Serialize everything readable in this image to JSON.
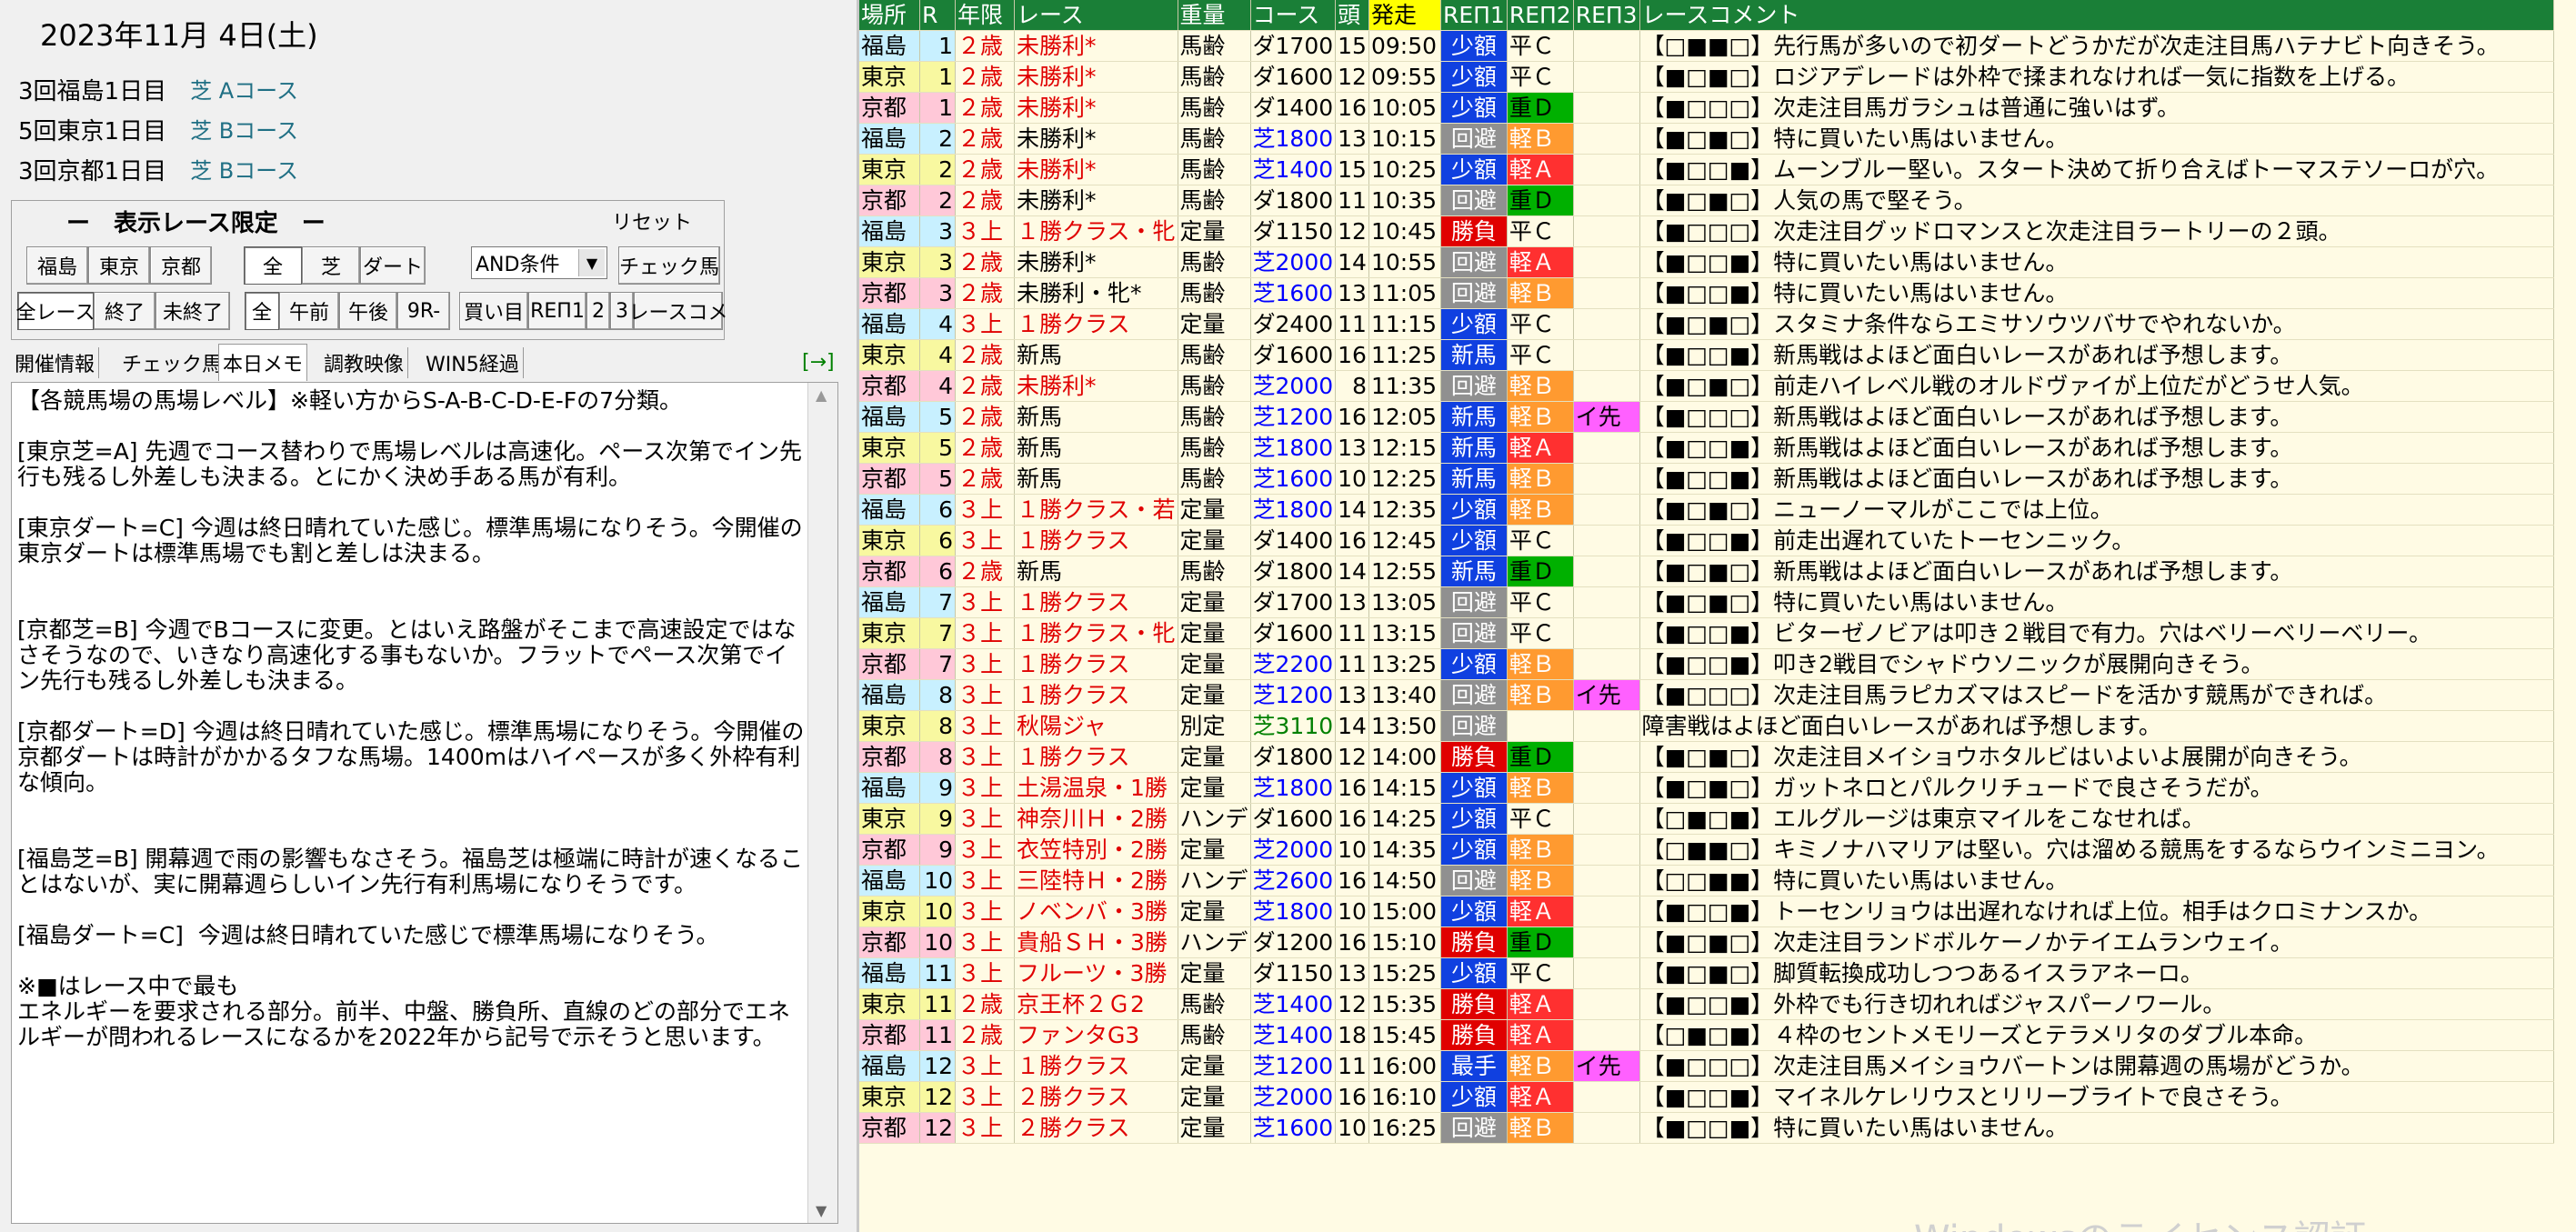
{
  "left": {
    "date": "2023年11月 4日(土)",
    "meets": [
      {
        "name": "3回福島1日目",
        "course": "芝 Aコース"
      },
      {
        "name": "5回東京1日目",
        "course": "芝 Bコース"
      },
      {
        "name": "3回京都1日目",
        "course": "芝 Bコース"
      }
    ],
    "filter": {
      "title": "ー　表示レース限定　ー",
      "reset": "リセット",
      "buttons_row1": [
        "福島",
        "東京",
        "京都",
        "全",
        "芝",
        "ダート"
      ],
      "select_value": "AND条件",
      "check_horse": "チェック馬",
      "buttons_row2": [
        "全レース",
        "終了",
        "未終了",
        "全",
        "午前",
        "午後",
        "9R-",
        "買い目",
        "REΠ1",
        "2",
        "3",
        "レースコメ"
      ]
    },
    "tabs": [
      "開催情報",
      "チェック馬",
      "本日メモ",
      "調教映像",
      "WIN5経過"
    ],
    "tab_arrow": "[→]",
    "memo": "【各競馬場の馬場レベル】※軽い方からS-A-B-C-D-E-Fの7分類。\n\n[東京芝=A] 先週でコース替わりで馬場レベルは高速化。ペース次第でイン先行も残るし外差しも決まる。とにかく決め手ある馬が有利。\n\n[東京ダート=C] 今週は終日晴れていた感じ。標準馬場になりそう。今開催の東京ダートは標準馬場でも割と差しは決まる。\n\n\n[京都芝=B] 今週でBコースに変更。とはいえ路盤がそこまで高速設定ではなさそうなので、いきなり高速化する事もないか。フラットでペース次第でイン先行も残るし外差しも決まる。\n\n[京都ダート=D] 今週は終日晴れていた感じ。標準馬場になりそう。今開催の京都ダートは時計がかかるタフな馬場。1400mはハイペースが多く外枠有利な傾向。\n\n\n[福島芝=B] 開幕週で雨の影響もなさそう。福島芝は極端に時計が速くなることはないが、実に開幕週らしいイン先行有利馬場になりそうです。\n\n[福島ダート=C]  今週は終日晴れていた感じで標準馬場になりそう。\n\n※■はレース中で最も\nエネルギーを要求される部分。前半、中盤、勝負所、直線のどの部分でエネルギーが問われるレースになるかを2022年から記号で示そうと思います。"
  },
  "grid": {
    "headers": [
      "場所",
      "R",
      "年限",
      "レース",
      "重量",
      "コース",
      "頭",
      "発走",
      "REΠ1",
      "REΠ2",
      "REΠ3",
      "レースコメント"
    ],
    "rows": [
      {
        "v": "福島",
        "r": "1",
        "nen": "２歳",
        "race": "未勝利*",
        "jyu": "馬齢",
        "course": "ダ1700",
        "head": "15",
        "time": "09:50",
        "r1": "少額",
        "r2": "平Ｃ",
        "r3": "",
        "cmt": "【□■■□】先行馬が多いので初ダートどうかだが次走注目馬ハテナビト向きそう。"
      },
      {
        "v": "東京",
        "r": "1",
        "nen": "２歳",
        "race": "未勝利*",
        "jyu": "馬齢",
        "course": "ダ1600",
        "head": "12",
        "time": "09:55",
        "r1": "少額",
        "r2": "平Ｃ",
        "r3": "",
        "cmt": "【■□■□】ロジアデレードは外枠で揉まれなければ一気に指数を上げる。"
      },
      {
        "v": "京都",
        "r": "1",
        "nen": "２歳",
        "race": "未勝利*",
        "jyu": "馬齢",
        "course": "ダ1400",
        "head": "16",
        "time": "10:05",
        "r1": "少額",
        "r2": "重Ｄ",
        "r3": "",
        "cmt": "【■□□□】次走注目馬ガラシュは普通に強いはず。"
      },
      {
        "v": "福島",
        "r": "2",
        "nen": "２歳",
        "race": "未勝利*",
        "jyu": "馬齢",
        "course": "芝1800",
        "head": "13",
        "time": "10:15",
        "r1": "回避",
        "r2": "軽Ｂ",
        "r3": "",
        "cmt": "【■□■□】特に買いたい馬はいません。"
      },
      {
        "v": "東京",
        "r": "2",
        "nen": "２歳",
        "race": "未勝利*",
        "jyu": "馬齢",
        "course": "芝1400",
        "head": "15",
        "time": "10:25",
        "r1": "少額",
        "r2": "軽Ａ",
        "r3": "",
        "cmt": "【■□□■】ムーンブルー堅い。スタート決めて折り合えばトーマステソーロが穴。"
      },
      {
        "v": "京都",
        "r": "2",
        "nen": "２歳",
        "race": "未勝利*",
        "jyu": "馬齢",
        "course": "ダ1800",
        "head": "11",
        "time": "10:35",
        "r1": "回避",
        "r2": "重Ｄ",
        "r3": "",
        "cmt": "【■□■□】人気の馬で堅そう。"
      },
      {
        "v": "福島",
        "r": "3",
        "nen": "３上",
        "race": "１勝クラス・牝",
        "jyu": "定量",
        "course": "ダ1150",
        "head": "12",
        "time": "10:45",
        "r1": "勝負",
        "r2": "平Ｃ",
        "r3": "",
        "cmt": "【■□□□】次走注目グッドロマンスと次走注目ラートリーの２頭。"
      },
      {
        "v": "東京",
        "r": "3",
        "nen": "２歳",
        "race": "未勝利*",
        "jyu": "馬齢",
        "course": "芝2000",
        "head": "14",
        "time": "10:55",
        "r1": "回避",
        "r2": "軽Ａ",
        "r3": "",
        "cmt": "【■□□■】特に買いたい馬はいません。"
      },
      {
        "v": "京都",
        "r": "3",
        "nen": "２歳",
        "race": "未勝利・牝*",
        "jyu": "馬齢",
        "course": "芝1600",
        "head": "13",
        "time": "11:05",
        "r1": "回避",
        "r2": "軽Ｂ",
        "r3": "",
        "cmt": "【■□□■】特に買いたい馬はいません。"
      },
      {
        "v": "福島",
        "r": "4",
        "nen": "３上",
        "race": "１勝クラス",
        "jyu": "定量",
        "course": "ダ2400",
        "head": "11",
        "time": "11:15",
        "r1": "少額",
        "r2": "平Ｃ",
        "r3": "",
        "cmt": "【■□■□】スタミナ条件ならエミサソウツバサでやれないか。"
      },
      {
        "v": "東京",
        "r": "4",
        "nen": "２歳",
        "race": "新馬",
        "jyu": "馬齢",
        "course": "ダ1600",
        "head": "16",
        "time": "11:25",
        "r1": "新馬",
        "r2": "平Ｃ",
        "r3": "",
        "cmt": "【■□□■】新馬戦はよほど面白いレースがあれば予想します。"
      },
      {
        "v": "京都",
        "r": "4",
        "nen": "２歳",
        "race": "未勝利*",
        "jyu": "馬齢",
        "course": "芝2000",
        "head": "8",
        "time": "11:35",
        "r1": "回避",
        "r2": "軽Ｂ",
        "r3": "",
        "cmt": "【■□■□】前走ハイレベル戦のオルドヴァイが上位だがどうせ人気。"
      },
      {
        "v": "福島",
        "r": "5",
        "nen": "２歳",
        "race": "新馬",
        "jyu": "馬齢",
        "course": "芝1200",
        "head": "16",
        "time": "12:05",
        "r1": "新馬",
        "r2": "軽Ｂ",
        "r3": "イ先",
        "cmt": "【■□□□】新馬戦はよほど面白いレースがあれば予想します。"
      },
      {
        "v": "東京",
        "r": "5",
        "nen": "２歳",
        "race": "新馬",
        "jyu": "馬齢",
        "course": "芝1800",
        "head": "13",
        "time": "12:15",
        "r1": "新馬",
        "r2": "軽Ａ",
        "r3": "",
        "cmt": "【■□□■】新馬戦はよほど面白いレースがあれば予想します。"
      },
      {
        "v": "京都",
        "r": "5",
        "nen": "２歳",
        "race": "新馬",
        "jyu": "馬齢",
        "course": "芝1600",
        "head": "10",
        "time": "12:25",
        "r1": "新馬",
        "r2": "軽Ｂ",
        "r3": "",
        "cmt": "【■□□■】新馬戦はよほど面白いレースがあれば予想します。"
      },
      {
        "v": "福島",
        "r": "6",
        "nen": "３上",
        "race": "１勝クラス・若",
        "jyu": "定量",
        "course": "芝1800",
        "head": "14",
        "time": "12:35",
        "r1": "少額",
        "r2": "軽Ｂ",
        "r3": "",
        "cmt": "【■□■□】ニューノーマルがここでは上位。"
      },
      {
        "v": "東京",
        "r": "6",
        "nen": "３上",
        "race": "１勝クラス",
        "jyu": "定量",
        "course": "ダ1400",
        "head": "16",
        "time": "12:45",
        "r1": "少額",
        "r2": "平Ｃ",
        "r3": "",
        "cmt": "【■□□■】前走出遅れていたトーセンニック。"
      },
      {
        "v": "京都",
        "r": "6",
        "nen": "２歳",
        "race": "新馬",
        "jyu": "馬齢",
        "course": "ダ1800",
        "head": "14",
        "time": "12:55",
        "r1": "新馬",
        "r2": "重Ｄ",
        "r3": "",
        "cmt": "【■□■□】新馬戦はよほど面白いレースがあれば予想します。"
      },
      {
        "v": "福島",
        "r": "7",
        "nen": "３上",
        "race": "１勝クラス",
        "jyu": "定量",
        "course": "ダ1700",
        "head": "13",
        "time": "13:05",
        "r1": "回避",
        "r2": "平Ｃ",
        "r3": "",
        "cmt": "【■□■□】特に買いたい馬はいません。"
      },
      {
        "v": "東京",
        "r": "7",
        "nen": "３上",
        "race": "１勝クラス・牝",
        "jyu": "定量",
        "course": "ダ1600",
        "head": "11",
        "time": "13:15",
        "r1": "回避",
        "r2": "平Ｃ",
        "r3": "",
        "cmt": "【■□□■】ビターゼノビアは叩き２戦目で有力。穴はベリーベリーベリー。"
      },
      {
        "v": "京都",
        "r": "7",
        "nen": "３上",
        "race": "１勝クラス",
        "jyu": "定量",
        "course": "芝2200",
        "head": "11",
        "time": "13:25",
        "r1": "少額",
        "r2": "軽Ｂ",
        "r3": "",
        "cmt": "【■□□■】叩き2戦目でシャドウソニックが展開向きそう。"
      },
      {
        "v": "福島",
        "r": "8",
        "nen": "３上",
        "race": "１勝クラス",
        "jyu": "定量",
        "course": "芝1200",
        "head": "13",
        "time": "13:40",
        "r1": "回避",
        "r2": "軽Ｂ",
        "r3": "イ先",
        "cmt": "【■□□□】次走注目馬ラピカズマはスピードを活かす競馬ができれば。"
      },
      {
        "v": "東京",
        "r": "8",
        "nen": "３上",
        "race": "秋陽ジャ",
        "jyu": "別定",
        "course": "芝3110",
        "head": "14",
        "time": "13:50",
        "r1": "回避",
        "r2": "",
        "r3": "",
        "cmt": "障害戦はよほど面白いレースがあれば予想します。"
      },
      {
        "v": "京都",
        "r": "8",
        "nen": "３上",
        "race": "１勝クラス",
        "jyu": "定量",
        "course": "ダ1800",
        "head": "12",
        "time": "14:00",
        "r1": "勝負",
        "r2": "重Ｄ",
        "r3": "",
        "cmt": "【■□■□】次走注目メイショウホタルビはいよいよ展開が向きそう。"
      },
      {
        "v": "福島",
        "r": "9",
        "nen": "３上",
        "race": "土湯温泉・1勝",
        "jyu": "定量",
        "course": "芝1800",
        "head": "16",
        "time": "14:15",
        "r1": "少額",
        "r2": "軽Ｂ",
        "r3": "",
        "cmt": "【■□■□】ガットネロとパルクリチュードで良さそうだが。"
      },
      {
        "v": "東京",
        "r": "9",
        "nen": "３上",
        "race": "神奈川Ｈ・2勝",
        "jyu": "ハンデ",
        "course": "ダ1600",
        "head": "16",
        "time": "14:25",
        "r1": "少額",
        "r2": "平Ｃ",
        "r3": "",
        "cmt": "【□■□■】エルグルージは東京マイルをこなせれば。"
      },
      {
        "v": "京都",
        "r": "9",
        "nen": "３上",
        "race": "衣笠特別・2勝",
        "jyu": "定量",
        "course": "芝2000",
        "head": "10",
        "time": "14:35",
        "r1": "少額",
        "r2": "軽Ｂ",
        "r3": "",
        "cmt": "【□■■□】キミノナハマリアは堅い。穴は溜める競馬をするならウインミニヨン。"
      },
      {
        "v": "福島",
        "r": "10",
        "nen": "３上",
        "race": "三陸特Ｈ・2勝",
        "jyu": "ハンデ",
        "course": "芝2600",
        "head": "16",
        "time": "14:50",
        "r1": "回避",
        "r2": "軽Ｂ",
        "r3": "",
        "cmt": "【□□■■】特に買いたい馬はいません。"
      },
      {
        "v": "東京",
        "r": "10",
        "nen": "３上",
        "race": "ノベンバ・3勝",
        "jyu": "定量",
        "course": "芝1800",
        "head": "10",
        "time": "15:00",
        "r1": "少額",
        "r2": "軽Ａ",
        "r3": "",
        "cmt": "【■□□■】トーセンリョウは出遅れなければ上位。相手はクロミナンスか。"
      },
      {
        "v": "京都",
        "r": "10",
        "nen": "３上",
        "race": "貴船ＳＨ・3勝",
        "jyu": "ハンデ",
        "course": "ダ1200",
        "head": "16",
        "time": "15:10",
        "r1": "勝負",
        "r2": "重Ｄ",
        "r3": "",
        "cmt": "【■□■□】次走注目ランドボルケーノかテイエムランウェイ。"
      },
      {
        "v": "福島",
        "r": "11",
        "nen": "３上",
        "race": "フルーツ・3勝",
        "jyu": "定量",
        "course": "ダ1150",
        "head": "13",
        "time": "15:25",
        "r1": "少額",
        "r2": "平Ｃ",
        "r3": "",
        "cmt": "【■□■□】脚質転換成功しつつあるイスラアネーロ。"
      },
      {
        "v": "東京",
        "r": "11",
        "nen": "２歳",
        "race": "京王杯２Ｇ2",
        "jyu": "馬齢",
        "course": "芝1400",
        "head": "12",
        "time": "15:35",
        "r1": "勝負",
        "r2": "軽Ａ",
        "r3": "",
        "cmt": "【■□□■】外枠でも行き切れればジャスパーノワール。"
      },
      {
        "v": "京都",
        "r": "11",
        "nen": "２歳",
        "race": "ファンタG3",
        "jyu": "馬齢",
        "course": "芝1400",
        "head": "18",
        "time": "15:45",
        "r1": "勝負",
        "r2": "軽Ａ",
        "r3": "",
        "cmt": "【□■□■】４枠のセントメモリーズとテラメリタのダブル本命。"
      },
      {
        "v": "福島",
        "r": "12",
        "nen": "３上",
        "race": "１勝クラス",
        "jyu": "定量",
        "course": "芝1200",
        "head": "11",
        "time": "16:00",
        "r1": "最手",
        "r2": "軽Ｂ",
        "r3": "イ先",
        "cmt": "【■□□□】次走注目馬メイショウバートンは開幕週の馬場がどうか。"
      },
      {
        "v": "東京",
        "r": "12",
        "nen": "３上",
        "race": "２勝クラス",
        "jyu": "定量",
        "course": "芝2000",
        "head": "16",
        "time": "16:10",
        "r1": "少額",
        "r2": "軽Ａ",
        "r3": "",
        "cmt": "【■□□■】マイネルケレリウスとリリーブライトで良さそう。"
      },
      {
        "v": "京都",
        "r": "12",
        "nen": "３上",
        "race": "２勝クラス",
        "jyu": "定量",
        "course": "芝1600",
        "head": "10",
        "time": "16:25",
        "r1": "回避",
        "r2": "軽Ｂ",
        "r3": "",
        "cmt": "【■□□■】特に買いたい馬はいません。"
      }
    ]
  },
  "watermark": "Windowsのライセンス認証"
}
